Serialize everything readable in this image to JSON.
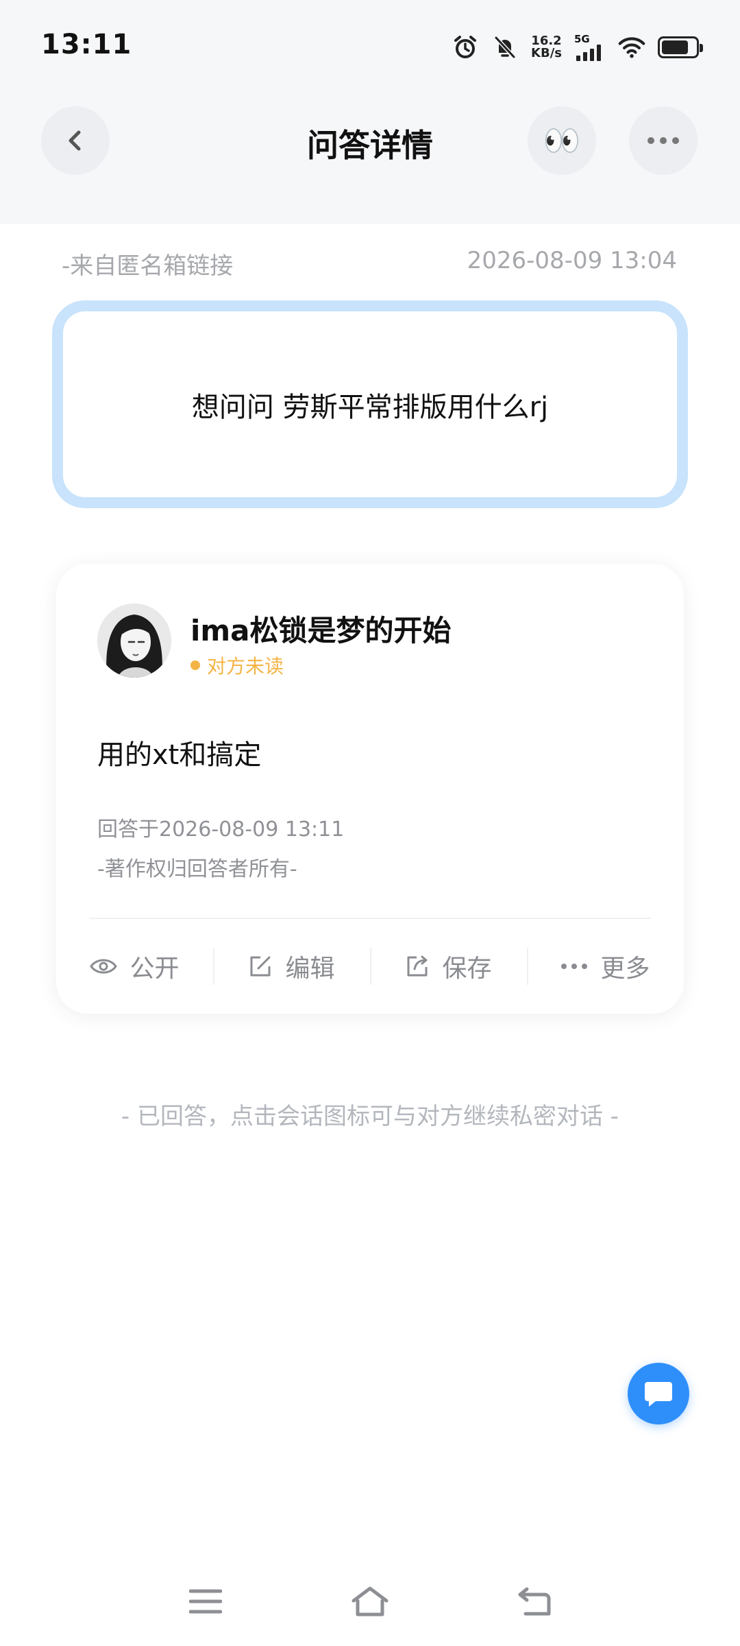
{
  "status_bar": {
    "time": "13:11",
    "net_speed_value": "16.2",
    "net_speed_unit": "KB/s",
    "network": "5G",
    "icons": [
      "alarm-icon",
      "mute-bell-icon",
      "signal-icon",
      "wifi-icon",
      "battery-icon"
    ]
  },
  "header": {
    "title": "问答详情",
    "back_icon": "chevron-left-icon",
    "eyes_emoji": "👀",
    "more_icon": "more-dots-icon"
  },
  "question": {
    "source": "-来自匿名箱链接",
    "time": "2026-08-09 13:04",
    "text": "想问问 劳斯平常排版用什么rj",
    "border_color": "#c8e3fb"
  },
  "answer": {
    "author": "ima松锁是梦的开始",
    "read_status": "对方未读",
    "read_status_color": "#f4b445",
    "text": "用的xt和搞定",
    "answered_at": "回答于2026-08-09 13:11",
    "copyright": "-著作权归回答者所有-",
    "actions": [
      {
        "label": "公开",
        "icon": "eye-icon"
      },
      {
        "label": "编辑",
        "icon": "edit-icon"
      },
      {
        "label": "保存",
        "icon": "share-export-icon"
      },
      {
        "label": "更多",
        "icon": "more-dots-icon"
      }
    ]
  },
  "footer_hint": "- 已回答，点击会话图标可与对方继续私密对话 -",
  "chat_fab": {
    "icon": "chat-bubble-icon",
    "color": "#2e8ffb"
  },
  "system_nav": {
    "icons": [
      "menu-icon",
      "home-icon",
      "back-icon"
    ]
  }
}
